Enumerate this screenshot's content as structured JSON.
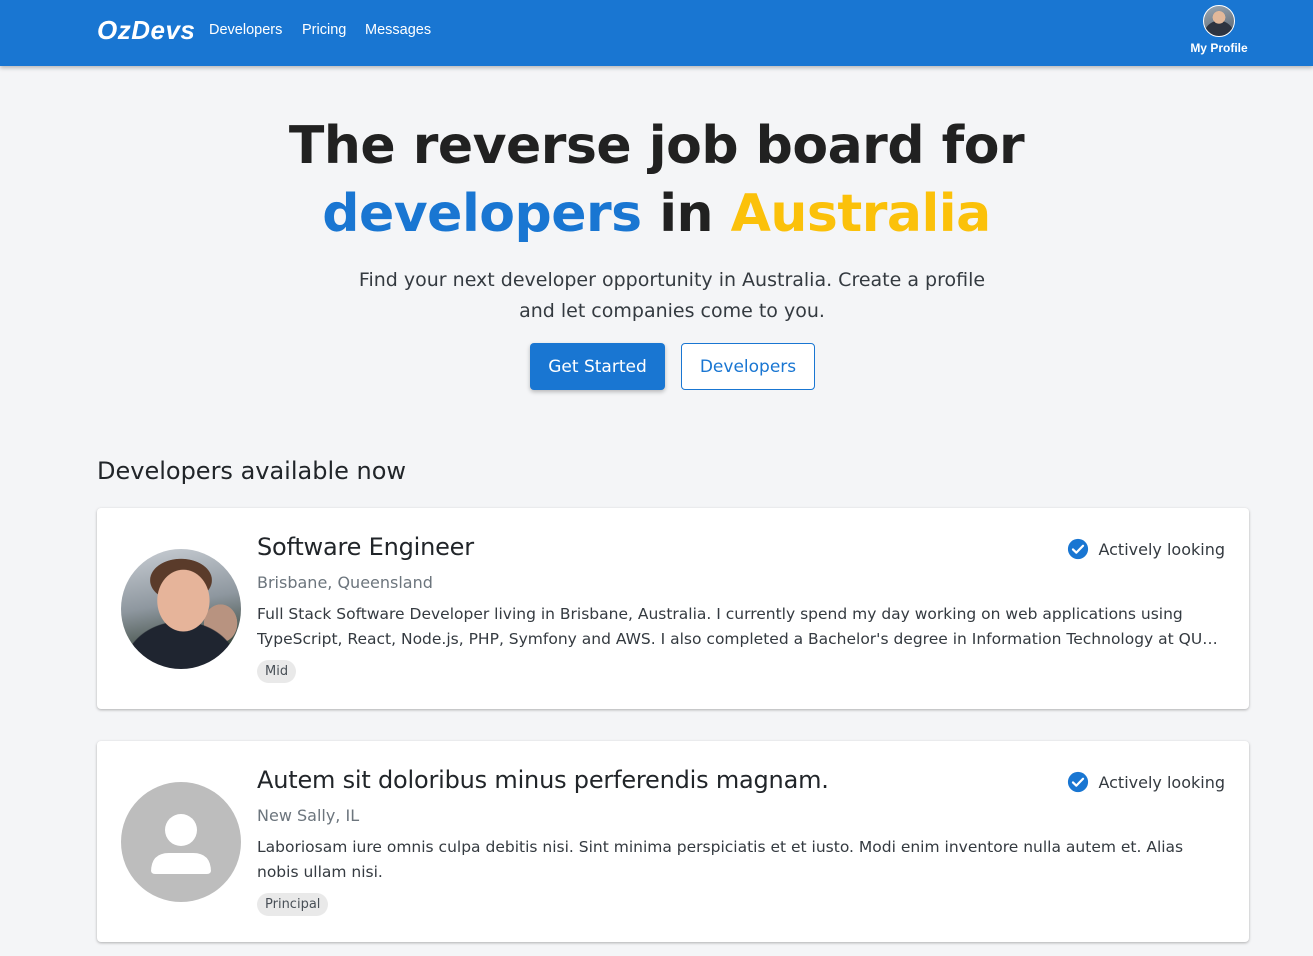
{
  "nav": {
    "brand": "OzDevs",
    "links": [
      "Developers",
      "Pricing",
      "Messages"
    ],
    "profile_label": "My Profile"
  },
  "hero": {
    "title_line1": "The reverse job board for",
    "title_word_blue": "developers",
    "title_word_mid": " in ",
    "title_word_yellow": "Australia",
    "subtitle": "Find your next developer opportunity in Australia. Create a profile and let companies come to you.",
    "primary_button": "Get Started",
    "secondary_button": "Developers"
  },
  "section": {
    "heading": "Developers available now"
  },
  "developers": [
    {
      "title": "Software Engineer",
      "location": "Brisbane, Queensland",
      "bio": "Full Stack Software Developer living in Brisbane, Australia. I currently spend my day working on web applications using TypeScript, React, Node.js, PHP, Symfony and AWS. I also completed a Bachelor's degree in Information Technology at QUT, majoring in Computer Science.",
      "level": "Mid",
      "status": "Actively looking",
      "avatar": "photo"
    },
    {
      "title": "Autem sit doloribus minus perferendis magnam.",
      "location": "New Sally, IL",
      "bio": "Laboriosam iure omnis culpa debitis nisi. Sint minima perspiciatis et et iusto. Modi enim inventore nulla autem et. Alias nobis ullam nisi.",
      "level": "Principal",
      "status": "Actively looking",
      "avatar": "person-placeholder-icon"
    }
  ],
  "colors": {
    "primary": "#1976d2",
    "accent_yellow": "#fbc10a",
    "background": "#f4f5f7"
  }
}
